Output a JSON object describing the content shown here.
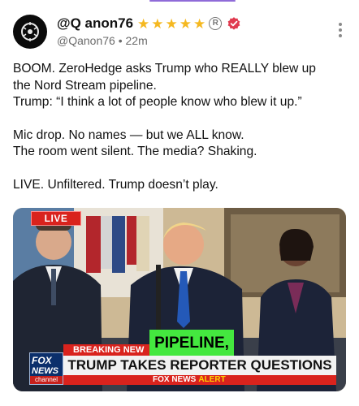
{
  "account": {
    "display_name": "@Q anon76",
    "stars": [
      "★",
      "★",
      "★",
      "★",
      "★"
    ],
    "reg_mark": "R",
    "handle": "@Qanon76",
    "separator": "•",
    "time": "22m",
    "verified_icon": "verified-badge-icon",
    "avatar_icon": "ring-logo-icon"
  },
  "post": {
    "lines1": [
      "BOOM. ZeroHedge asks Trump who REALLY blew up",
      "the Nord Stream pipeline.",
      "Trump: “I think a lot of people know who blew it up.”"
    ],
    "lines2": [
      "Mic drop. No names — but we ALL know.",
      "The room went silent. The media? Shaking."
    ],
    "lines3": [
      "LIVE. Unfiltered. Trump doesn’t play."
    ]
  },
  "media": {
    "live_badge": "LIVE",
    "caption": "PIPELINE,",
    "breaking_label": "BREAKING NEW",
    "headline": "TRUMP TAKES REPORTER QUESTIONS",
    "alert_left": "FOX NEWS",
    "alert_right": "ALERT",
    "logo_line1": "FOX",
    "logo_line2": "NEWS",
    "logo_line3": "channel"
  },
  "colors": {
    "accent_purple": "#8f6bd8",
    "star_gold": "#f5b820",
    "verified_red": "#e03a4f",
    "fox_red": "#d9231d",
    "caption_green": "#44e83f"
  }
}
